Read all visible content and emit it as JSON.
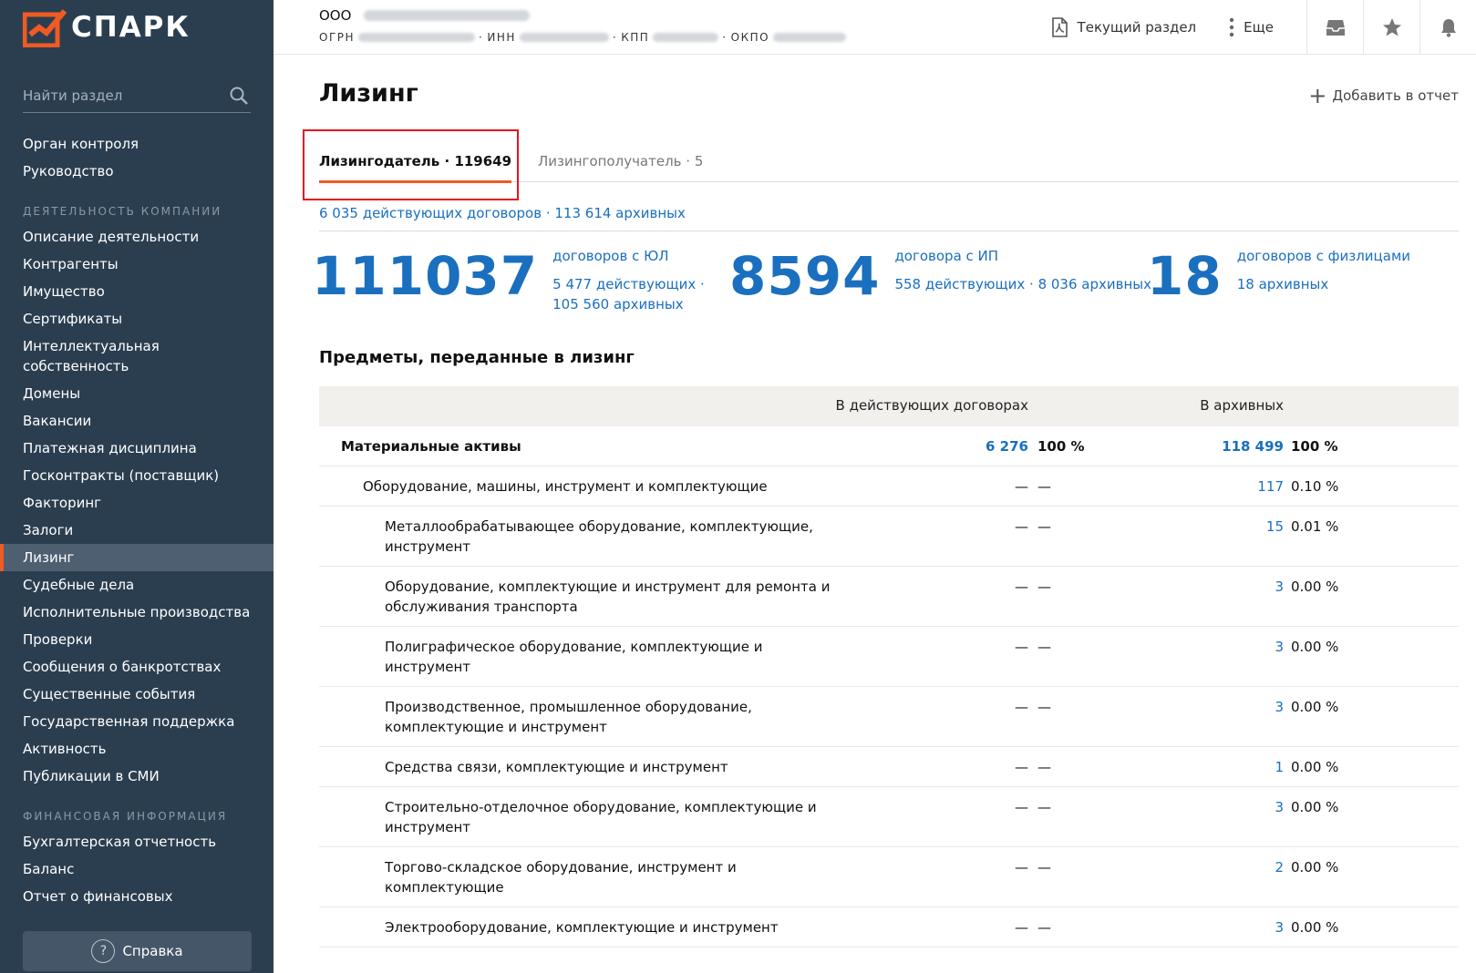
{
  "app": {
    "logo_text": "СПАРК",
    "search_placeholder": "Найти раздел",
    "help_label": "Справка",
    "colors": {
      "sidebar_bg": "#2b3e50",
      "accent": "#f15a22",
      "link": "#1a6fbf"
    }
  },
  "sidebar": {
    "top_items": [
      "Орган контроля",
      "Руководство"
    ],
    "section_activity": "Деятельность компании",
    "activity_items": [
      "Описание деятельности",
      "Контрагенты",
      "Имущество",
      "Сертификаты",
      "Интеллектуальная собственность",
      "Домены",
      "Вакансии",
      "Платежная дисциплина",
      "Госконтракты (поставщик)",
      "Факторинг",
      "Залоги",
      "Лизинг",
      "Судебные дела",
      "Исполнительные производства",
      "Проверки",
      "Сообщения о банкротствах",
      "Существенные события",
      "Государственная поддержка",
      "Активность",
      "Публикации в СМИ"
    ],
    "active_item": "Лизинг",
    "section_finance": "Финансовая информация",
    "finance_items": [
      "Бухгалтерская отчетность",
      "Баланс",
      "Отчет о финансовых"
    ]
  },
  "header": {
    "company_prefix": "ООО",
    "code_labels": [
      "ОГРН",
      "ИНН",
      "КПП",
      "ОКПО"
    ],
    "current_section": "Текущий раздел",
    "more": "Еще",
    "icons": [
      "pdf-icon",
      "more-vertical-icon",
      "inbox-icon",
      "star-icon",
      "bell-icon"
    ]
  },
  "main": {
    "title": "Лизинг",
    "add_report": "Добавить в отчет",
    "tabs": [
      {
        "label": "Лизингодатель",
        "count": "119649",
        "active": true
      },
      {
        "label": "Лизингополучатель",
        "count": "5",
        "active": false
      }
    ],
    "contracts_summary": "6 035 действующих договоров · 113 614 архивных",
    "stats": [
      {
        "number": "111037",
        "label": "договоров с ЮЛ",
        "line1": "5 477 действующих ·",
        "line2": "105 560 архивных"
      },
      {
        "number": "8594",
        "label": "договора с ИП",
        "line1": "558 действующих · 8 036 архивных",
        "line2": ""
      },
      {
        "number": "18",
        "label": "договоров с физлицами",
        "line1": "18 архивных",
        "line2": ""
      }
    ],
    "section_title": "Предметы, переданные в лизинг",
    "table": {
      "headers": {
        "active": "В действующих договорах",
        "archive": "В архивных"
      },
      "rows": [
        {
          "level": 0,
          "name": [
            "Материальные активы"
          ],
          "act_num": "6 276",
          "act_pct": "100 %",
          "arch_num": "118 499",
          "arch_pct": "100 %",
          "bold": true
        },
        {
          "level": 1,
          "name": [
            "Оборудование, машины, инструмент и комплектующие"
          ],
          "act_num": "—",
          "act_pct": "—",
          "arch_num": "117",
          "arch_pct": "0.10 %"
        },
        {
          "level": 2,
          "name": [
            "Металлообрабатывающее оборудование, комплектующие,",
            "инструмент"
          ],
          "act_num": "—",
          "act_pct": "—",
          "arch_num": "15",
          "arch_pct": "0.01 %"
        },
        {
          "level": 2,
          "name": [
            "Оборудование, комплектующие и инструмент для ремонта и",
            "обслуживания транспорта"
          ],
          "act_num": "—",
          "act_pct": "—",
          "arch_num": "3",
          "arch_pct": "0.00 %"
        },
        {
          "level": 2,
          "name": [
            "Полиграфическое оборудование, комплектующие и",
            "инструмент"
          ],
          "act_num": "—",
          "act_pct": "—",
          "arch_num": "3",
          "arch_pct": "0.00 %"
        },
        {
          "level": 2,
          "name": [
            "Производственное, промышленное оборудование,",
            "комплектующие и инструмент"
          ],
          "act_num": "—",
          "act_pct": "—",
          "arch_num": "3",
          "arch_pct": "0.00 %"
        },
        {
          "level": 2,
          "name": [
            "Средства связи, комплектующие и инструмент"
          ],
          "act_num": "—",
          "act_pct": "—",
          "arch_num": "1",
          "arch_pct": "0.00 %"
        },
        {
          "level": 2,
          "name": [
            "Строительно-отделочное оборудование, комплектующие и",
            "инструмент"
          ],
          "act_num": "—",
          "act_pct": "—",
          "arch_num": "3",
          "arch_pct": "0.00 %"
        },
        {
          "level": 2,
          "name": [
            "Торгово-складское оборудование, инструмент и",
            "комплектующие"
          ],
          "act_num": "—",
          "act_pct": "—",
          "arch_num": "2",
          "arch_pct": "0.00 %"
        },
        {
          "level": 2,
          "name": [
            "Электрооборудование, комплектующие и инструмент"
          ],
          "act_num": "—",
          "act_pct": "—",
          "arch_num": "3",
          "arch_pct": "0.00 %"
        }
      ]
    }
  }
}
